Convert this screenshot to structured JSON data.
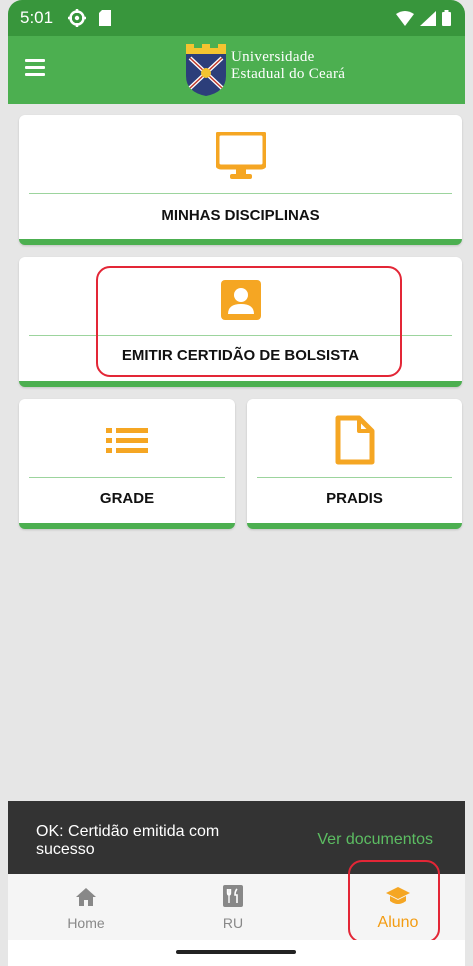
{
  "status_bar": {
    "time": "5:01"
  },
  "app_bar": {
    "logo_line1": "Universidade",
    "logo_line2": "Estadual do Ceará"
  },
  "cards": {
    "disciplinas": {
      "label": "MINHAS DISCIPLINAS",
      "icon": "monitor-icon"
    },
    "certidao": {
      "label": "EMITIR CERTIDÃO DE BOLSISTA",
      "icon": "person-badge-icon"
    },
    "grade": {
      "label": "GRADE",
      "icon": "list-icon"
    },
    "pradis": {
      "label": "PRADIS",
      "icon": "document-icon"
    }
  },
  "snackbar": {
    "message": "OK: Certidão emitida com sucesso",
    "action": "Ver documentos"
  },
  "bottom_nav": {
    "items": [
      {
        "label": "Home",
        "icon": "home-icon"
      },
      {
        "label": "RU",
        "icon": "restaurant-icon"
      },
      {
        "label": "Aluno",
        "icon": "graduation-cap-icon"
      }
    ],
    "active": "Aluno"
  },
  "colors": {
    "primary": "#4caf50",
    "status_bar": "#38963c",
    "accent": "#f5a623",
    "highlight": "#e32636",
    "snackbar_action": "#5cbd62"
  }
}
